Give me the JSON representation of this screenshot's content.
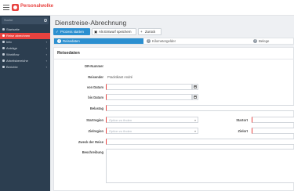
{
  "app": {
    "brand": "Personalwolke"
  },
  "sidebar": {
    "search_placeholder": "Suche",
    "items": [
      {
        "label": "Startseite",
        "active": false,
        "has_children": false
      },
      {
        "label": "Reise abrechnen",
        "active": true,
        "has_children": false
      },
      {
        "label": "Info",
        "active": false,
        "has_children": true
      },
      {
        "label": "Anträge",
        "active": false,
        "has_children": true
      },
      {
        "label": "Workflow",
        "active": false,
        "has_children": true
      },
      {
        "label": "Arbeitsbereiche",
        "active": false,
        "has_children": true
      },
      {
        "label": "Berichte",
        "active": false,
        "has_children": true
      }
    ]
  },
  "page": {
    "title": "Dienstreise-Abrechnung"
  },
  "toolbar": {
    "start_label": "Prozess starten",
    "draft_label": "Als Entwurf speichern",
    "back_label": "Zurück"
  },
  "steps": [
    {
      "number": "1",
      "label": "Reisedaten"
    },
    {
      "number": "2",
      "label": "Kilometergelder"
    },
    {
      "number": "3",
      "label": "Belege"
    }
  ],
  "form": {
    "section_title": "Reisedaten",
    "fields": {
      "id_label": "DR-Nummer",
      "reisender_label": "Reisender",
      "reisender_value": "Pracktikant André",
      "von_label": "von Datum",
      "bis_label": "bis Datum",
      "belastung_label": "Belastag",
      "startregion_label": "Startregion",
      "startregion_placeholder": "Option zu finden",
      "zielregion_label": "Zielregion",
      "zielregion_placeholder": "Option zu finden",
      "startort_label": "Startort",
      "zielort_label": "Zielort",
      "zweck_label": "Zweck der Reise",
      "beschreibung_label": "Beschreibung"
    }
  }
}
